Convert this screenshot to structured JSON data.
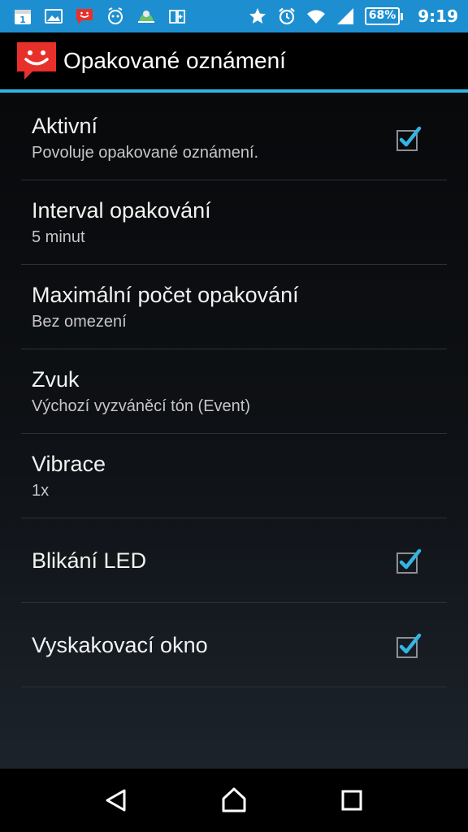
{
  "status_bar": {
    "notification_icons": [
      "calendar-icon",
      "image-icon",
      "app-notification-icon",
      "alarm-robot-icon",
      "weather-icon",
      "book-icon"
    ],
    "calendar_day": "1",
    "system_icons": [
      "star-icon",
      "alarm-clock-icon",
      "wifi-icon",
      "signal-icon"
    ],
    "battery": "68%",
    "time": "9:19"
  },
  "action_bar": {
    "title": "Opakované oznámení"
  },
  "preferences": [
    {
      "title": "Aktivní",
      "summary": "Povoluje opakované oznámení.",
      "checked": true
    },
    {
      "title": "Interval opakování",
      "summary": "5 minut"
    },
    {
      "title": "Maximální počet opakování",
      "summary": "Bez omezení"
    },
    {
      "title": "Zvuk",
      "summary": "Výchozí vyzváněcí tón (Event)"
    },
    {
      "title": "Vibrace",
      "summary": "1x"
    },
    {
      "title": "Blikání LED",
      "checked": true
    },
    {
      "title": "Vyskakovací okno",
      "checked": true
    }
  ],
  "colors": {
    "status_bar": "#1d8fd1",
    "accent": "#33b5e5",
    "app_icon": "#e8302a"
  },
  "nav_bar": {
    "buttons": [
      "back-icon",
      "home-icon",
      "recents-icon"
    ]
  }
}
